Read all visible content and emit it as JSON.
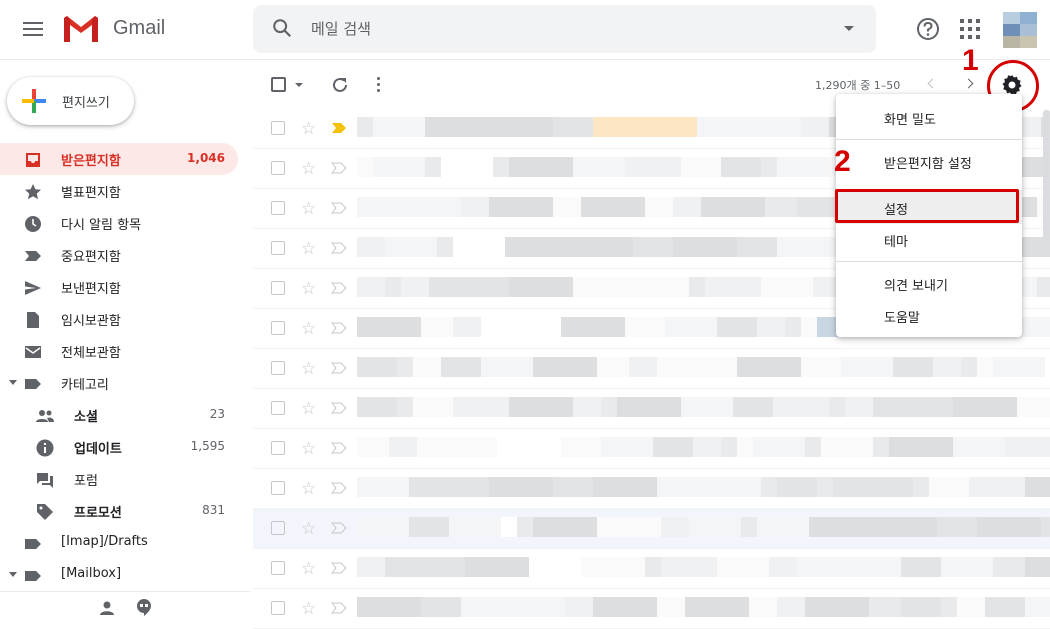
{
  "header": {
    "brand": "Gmail",
    "search_placeholder": "메일 검색"
  },
  "compose": {
    "label": "편지쓰기"
  },
  "sidebar": {
    "items": [
      {
        "label": "받은편지함",
        "count": "1,046",
        "icon": "inbox-icon",
        "active": true
      },
      {
        "label": "별표편지함",
        "count": "",
        "icon": "star-icon"
      },
      {
        "label": "다시 알림 항목",
        "count": "",
        "icon": "clock-icon"
      },
      {
        "label": "중요편지함",
        "count": "",
        "icon": "important-icon"
      },
      {
        "label": "보낸편지함",
        "count": "",
        "icon": "send-icon"
      },
      {
        "label": "임시보관함",
        "count": "",
        "icon": "draft-icon"
      },
      {
        "label": "전체보관함",
        "count": "",
        "icon": "mail-icon"
      },
      {
        "label": "카테고리",
        "count": "",
        "icon": "label-icon"
      },
      {
        "label": "소셜",
        "count": "23",
        "icon": "people-icon"
      },
      {
        "label": "업데이트",
        "count": "1,595",
        "icon": "info-icon"
      },
      {
        "label": "포럼",
        "count": "",
        "icon": "forum-icon"
      },
      {
        "label": "프로모션",
        "count": "831",
        "icon": "tag-icon"
      },
      {
        "label": "[Imap]/Drafts",
        "count": "",
        "icon": "label-icon"
      },
      {
        "label": "[Mailbox]",
        "count": "",
        "icon": "label-icon"
      }
    ]
  },
  "toolbar": {
    "pagination": "1,290개 중 1–50"
  },
  "settings_menu": {
    "items": [
      "화면 밀도",
      "받은편지함 설정",
      "설정",
      "테마",
      "의견 보내기",
      "도움말"
    ]
  },
  "annotations": {
    "step1": "1",
    "step2": "2",
    "color": "#d50000"
  },
  "colors": {
    "accent": "#d93025",
    "active_bg": "#fce8e6"
  }
}
